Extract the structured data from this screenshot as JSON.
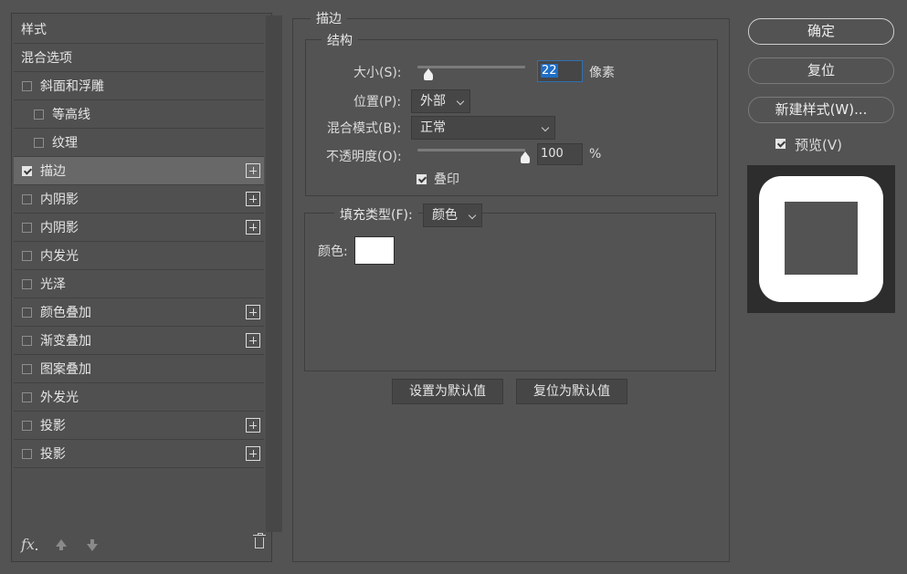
{
  "sidebar": {
    "items": [
      {
        "label": "样式",
        "kind": "header"
      },
      {
        "label": "混合选项",
        "kind": "header"
      },
      {
        "label": "斜面和浮雕",
        "checked": false,
        "indent": 0,
        "plus": false
      },
      {
        "label": "等高线",
        "checked": false,
        "indent": 1,
        "plus": false
      },
      {
        "label": "纹理",
        "checked": false,
        "indent": 1,
        "plus": false
      },
      {
        "label": "描边",
        "checked": true,
        "indent": 0,
        "plus": true,
        "selected": true
      },
      {
        "label": "内阴影",
        "checked": false,
        "indent": 0,
        "plus": true
      },
      {
        "label": "内阴影",
        "checked": false,
        "indent": 0,
        "plus": true
      },
      {
        "label": "内发光",
        "checked": false,
        "indent": 0,
        "plus": false
      },
      {
        "label": "光泽",
        "checked": false,
        "indent": 0,
        "plus": false
      },
      {
        "label": "颜色叠加",
        "checked": false,
        "indent": 0,
        "plus": true
      },
      {
        "label": "渐变叠加",
        "checked": false,
        "indent": 0,
        "plus": true
      },
      {
        "label": "图案叠加",
        "checked": false,
        "indent": 0,
        "plus": false
      },
      {
        "label": "外发光",
        "checked": false,
        "indent": 0,
        "plus": false
      },
      {
        "label": "投影",
        "checked": false,
        "indent": 0,
        "plus": true
      },
      {
        "label": "投影",
        "checked": false,
        "indent": 0,
        "plus": true
      }
    ],
    "footer": {
      "fx_label": "fx"
    }
  },
  "stroke": {
    "group_title": "描边",
    "structure": {
      "title": "结构",
      "size_label": "大小(S):",
      "size_value": "22",
      "size_unit": "像素",
      "size_level": 0.1,
      "position_label": "位置(P):",
      "position_value": "外部",
      "blend_label": "混合模式(B):",
      "blend_value": "正常",
      "opacity_label": "不透明度(O):",
      "opacity_value": "100",
      "opacity_unit": "%",
      "opacity_level": 1.0,
      "overprint_label": "叠印",
      "overprint_checked": true
    },
    "fill": {
      "type_label": "填充类型(F):",
      "type_value": "颜色",
      "color_label": "颜色:",
      "color": "#ffffff"
    },
    "set_default_label": "设置为默认值",
    "reset_default_label": "复位为默认值"
  },
  "actions": {
    "ok_label": "确定",
    "reset_label": "复位",
    "new_style_label": "新建样式(W)...",
    "preview_label": "预览(V)",
    "preview_checked": true
  },
  "colors": {
    "background": "#535353",
    "selected_row": "#686868",
    "focus": "#2f6fb3"
  }
}
